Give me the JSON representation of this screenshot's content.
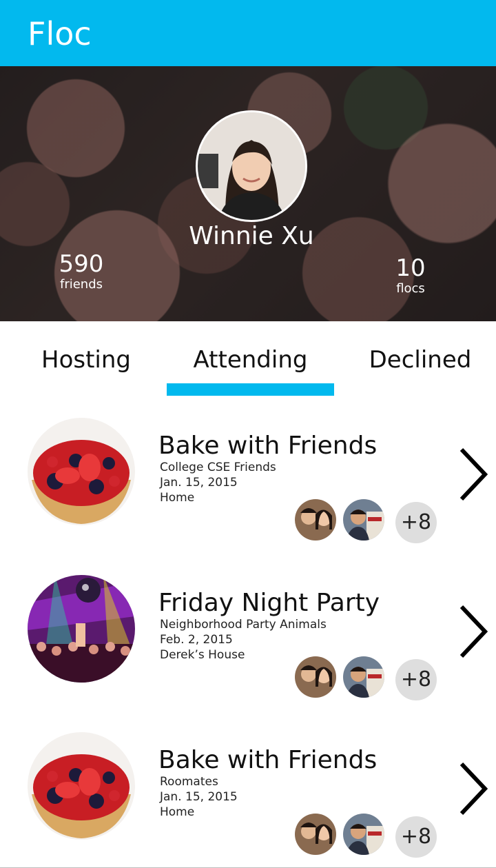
{
  "app": {
    "title": "Floc",
    "accent": "#02b9ee"
  },
  "profile": {
    "name": "Winnie Xu",
    "friends_count": "590",
    "friends_label": "friends",
    "flocs_count": "10",
    "flocs_label": "flocs"
  },
  "tabs": [
    {
      "label": "Hosting",
      "active": false
    },
    {
      "label": "Attending",
      "active": true
    },
    {
      "label": "Declined",
      "active": false
    }
  ],
  "events": [
    {
      "title": "Bake with Friends",
      "group": "College CSE Friends",
      "date": "Jan. 15, 2015",
      "location": "Home",
      "more": "+8",
      "image": "berry-tart"
    },
    {
      "title": "Friday Night Party",
      "group": "Neighborhood Party Animals",
      "date": "Feb. 2, 2015",
      "location": "Derek’s House",
      "more": "+8",
      "image": "party-crowd"
    },
    {
      "title": "Bake with Friends",
      "group": "Roomates",
      "date": "Jan. 15, 2015",
      "location": "Home",
      "more": "+8",
      "image": "berry-tart"
    }
  ]
}
